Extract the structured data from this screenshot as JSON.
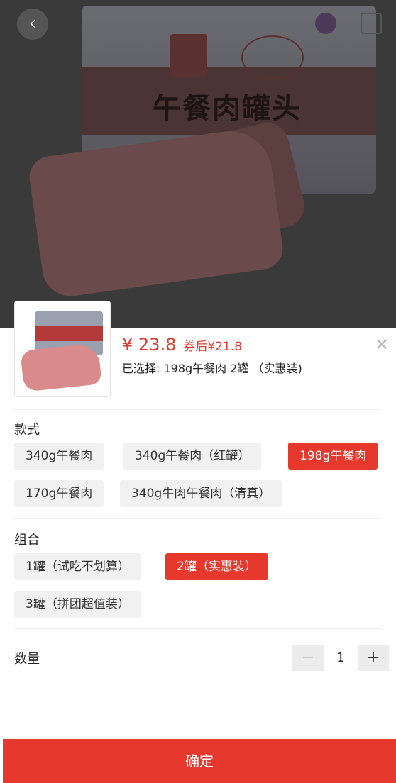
{
  "backdrop": {
    "can_title": "午餐肉罐头",
    "back_icon": "chevron-left-icon",
    "cart_icon": "cart-icon",
    "share_icon": "share-icon"
  },
  "product": {
    "price": "¥ 23.8",
    "coupon_price": "券后¥21.8",
    "selected_text": "已选择: 198g午餐肉 2罐 （实惠装)",
    "close_icon": "close-icon"
  },
  "style_section": {
    "label": "款式",
    "options": [
      {
        "label": "340g午餐肉",
        "active": false
      },
      {
        "label": "340g午餐肉（红罐）",
        "active": false
      },
      {
        "label": "198g午餐肉",
        "active": true
      },
      {
        "label": "170g午餐肉",
        "active": false
      },
      {
        "label": "340g牛肉午餐肉（清真）",
        "active": false
      }
    ]
  },
  "combo_section": {
    "label": "组合",
    "options": [
      {
        "label": "1罐（试吃不划算）",
        "active": false
      },
      {
        "label": "2罐（实惠装）",
        "active": true
      },
      {
        "label": "3罐（拼团超值装）",
        "active": false
      }
    ]
  },
  "quantity": {
    "label": "数量",
    "minus": "−",
    "value": "1",
    "plus": "+"
  },
  "confirm_label": "确定",
  "colors": {
    "accent": "#e6382d",
    "chip_bg": "#f1f1f1"
  }
}
